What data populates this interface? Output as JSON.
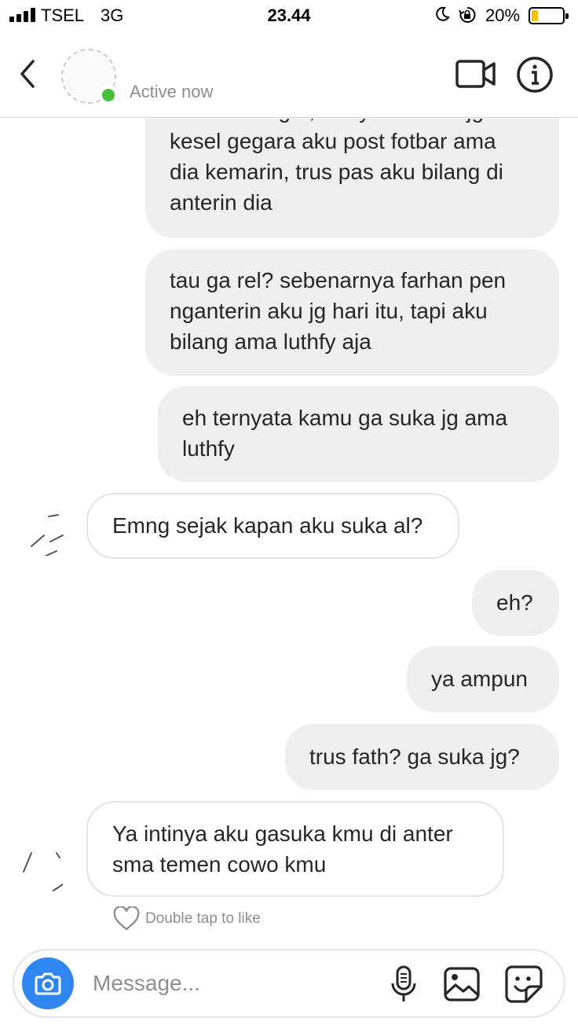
{
  "status_bar": {
    "carrier": "TSEL",
    "network": "3G",
    "time": "23.44",
    "battery_percent": "20%",
    "battery_level": 0.2
  },
  "header": {
    "status": "Active now"
  },
  "messages": [
    {
      "direction": "outgoing",
      "text": "aku baru inget, ternyata kamu jg\nkesel gegara aku post fotbar ama\ndia kemarin, trus pas aku bilang di\nanterin dia"
    },
    {
      "direction": "outgoing",
      "text": "tau ga rel? sebenarnya farhan pen\nnganterin aku jg hari itu, tapi aku\nbilang ama luthfy aja"
    },
    {
      "direction": "outgoing",
      "text": "eh ternyata kamu ga suka jg ama\nluthfy"
    },
    {
      "direction": "incoming",
      "text": "Emng sejak kapan aku suka al?"
    },
    {
      "direction": "outgoing",
      "text": "eh?"
    },
    {
      "direction": "outgoing",
      "text": "ya ampun"
    },
    {
      "direction": "outgoing",
      "text": "trus fath? ga suka jg?"
    },
    {
      "direction": "incoming",
      "text": "Ya intinya aku gasuka kmu di anter\nsma temen cowo kmu"
    }
  ],
  "like_hint": "Double tap to like",
  "composer": {
    "placeholder": "Message..."
  },
  "colors": {
    "active_green": "#44c03a",
    "camera_blue": "#2f86f0",
    "bubble_gray": "#efefef",
    "battery_yellow": "#f2c400"
  },
  "icons": [
    "back-chevron-icon",
    "video-camera-icon",
    "info-icon",
    "camera-icon",
    "microphone-icon",
    "gallery-icon",
    "sticker-icon",
    "heart-icon",
    "moon-icon",
    "rotation-lock-icon"
  ]
}
